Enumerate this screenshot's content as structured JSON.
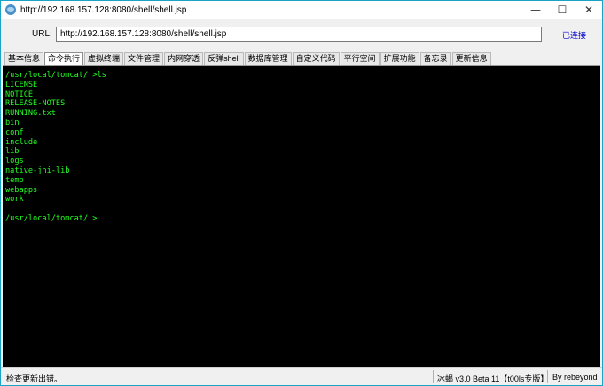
{
  "window": {
    "title": "http://192.168.157.128:8080/shell/shell.jsp",
    "controls": [
      "minimize",
      "maximize",
      "close"
    ]
  },
  "urlbar": {
    "label": "URL:",
    "value": "http://192.168.157.128:8080/shell/shell.jsp",
    "status": "已连接"
  },
  "tabs": [
    {
      "label": "基本信息",
      "active": false
    },
    {
      "label": "命令执行",
      "active": true
    },
    {
      "label": "虚拟终端",
      "active": false
    },
    {
      "label": "文件管理",
      "active": false
    },
    {
      "label": "内网穿透",
      "active": false
    },
    {
      "label": "反弹shell",
      "active": false
    },
    {
      "label": "数据库管理",
      "active": false
    },
    {
      "label": "自定义代码",
      "active": false
    },
    {
      "label": "平行空间",
      "active": false
    },
    {
      "label": "扩展功能",
      "active": false
    },
    {
      "label": "备忘录",
      "active": false
    },
    {
      "label": "更新信息",
      "active": false
    }
  ],
  "terminal": {
    "lines": [
      "/usr/local/tomcat/ >ls",
      "LICENSE",
      "NOTICE",
      "RELEASE-NOTES",
      "RUNNING.txt",
      "bin",
      "conf",
      "include",
      "lib",
      "logs",
      "native-jni-lib",
      "temp",
      "webapps",
      "work",
      "",
      "/usr/local/tomcat/ >"
    ],
    "text_color": "#22ff22",
    "background": "#000000"
  },
  "statusbar": {
    "message": "检查更新出错。",
    "version": "冰蝎 v3.0 Beta 11【t00ls专版】",
    "author": "By rebeyond"
  }
}
